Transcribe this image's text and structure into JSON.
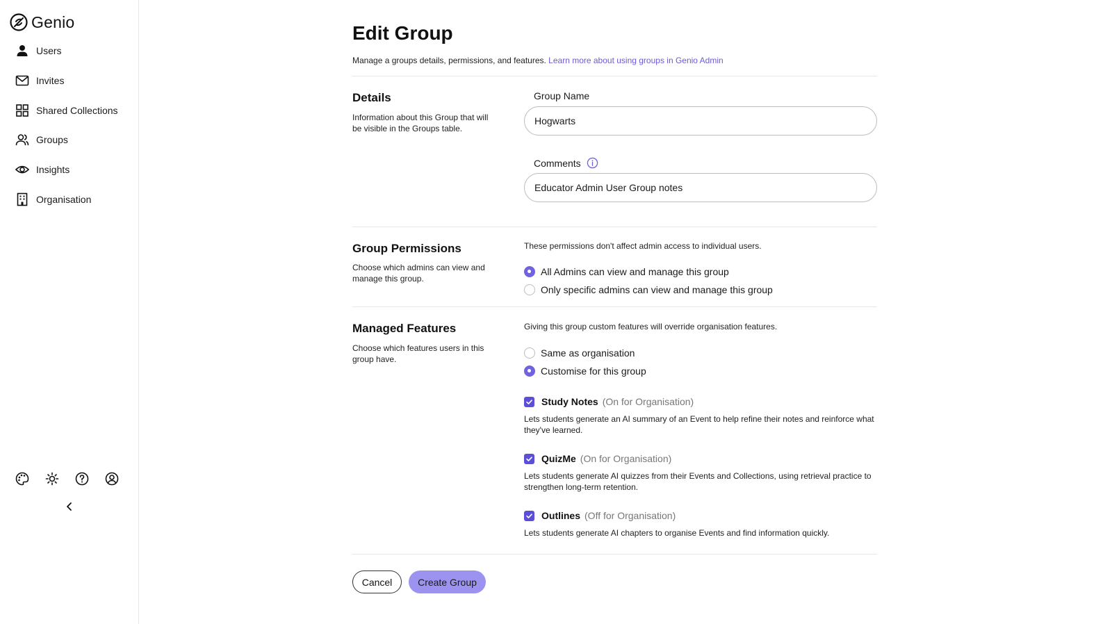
{
  "app": {
    "name": "Genio"
  },
  "sidebar": {
    "items": [
      {
        "label": "Users",
        "icon": "user-icon"
      },
      {
        "label": "Invites",
        "icon": "mail-icon"
      },
      {
        "label": "Shared Collections",
        "icon": "grid-icon"
      },
      {
        "label": "Groups",
        "icon": "users-icon"
      },
      {
        "label": "Insights",
        "icon": "eye-icon"
      },
      {
        "label": "Organisation",
        "icon": "building-icon"
      }
    ],
    "footer_icons": [
      "palette-icon",
      "sun-icon",
      "help-icon",
      "account-icon"
    ],
    "collapse_icon": "chevron-left-icon"
  },
  "page": {
    "title": "Edit Group",
    "subtitle": "Manage a groups details, permissions, and features.",
    "subtitle_link": "Learn more about using groups in Genio Admin"
  },
  "details": {
    "title": "Details",
    "description": "Information about this Group that will be visible in the Groups table.",
    "group_name_label": "Group Name",
    "group_name_value": "Hogwarts",
    "comments_label": "Comments",
    "comments_value": "Educator Admin User Group notes"
  },
  "permissions": {
    "title": "Group Permissions",
    "description": "Choose which admins can view and manage this group.",
    "note": "These permissions don't affect admin access to individual users.",
    "options": [
      {
        "label": "All Admins can view and manage this group",
        "selected": true
      },
      {
        "label": "Only specific admins can view and manage this group",
        "selected": false
      }
    ]
  },
  "features": {
    "title": "Managed Features",
    "description": "Choose which features users in this group have.",
    "note": "Giving this group custom features will override organisation features.",
    "options": [
      {
        "label": "Same as organisation",
        "selected": false
      },
      {
        "label": "Customise for this group",
        "selected": true
      }
    ],
    "items": [
      {
        "name": "Study Notes",
        "org_status": "(On for Organisation)",
        "description": "Lets students generate an AI summary of an Event to help refine their notes and reinforce what they've learned.",
        "checked": true
      },
      {
        "name": "QuizMe",
        "org_status": "(On for Organisation)",
        "description": "Lets students generate AI quizzes from their Events and Collections, using retrieval practice to strengthen long-term retention.",
        "checked": true
      },
      {
        "name": "Outlines",
        "org_status": "(Off for Organisation)",
        "description": "Lets students generate AI chapters to organise Events and find information quickly.",
        "checked": true
      }
    ]
  },
  "actions": {
    "cancel_label": "Cancel",
    "create_label": "Create Group"
  },
  "colors": {
    "accent": "#7063e0",
    "checkbox": "#5b4fd6",
    "primary_button": "#9c93f0",
    "link": "#6a5bd8"
  }
}
